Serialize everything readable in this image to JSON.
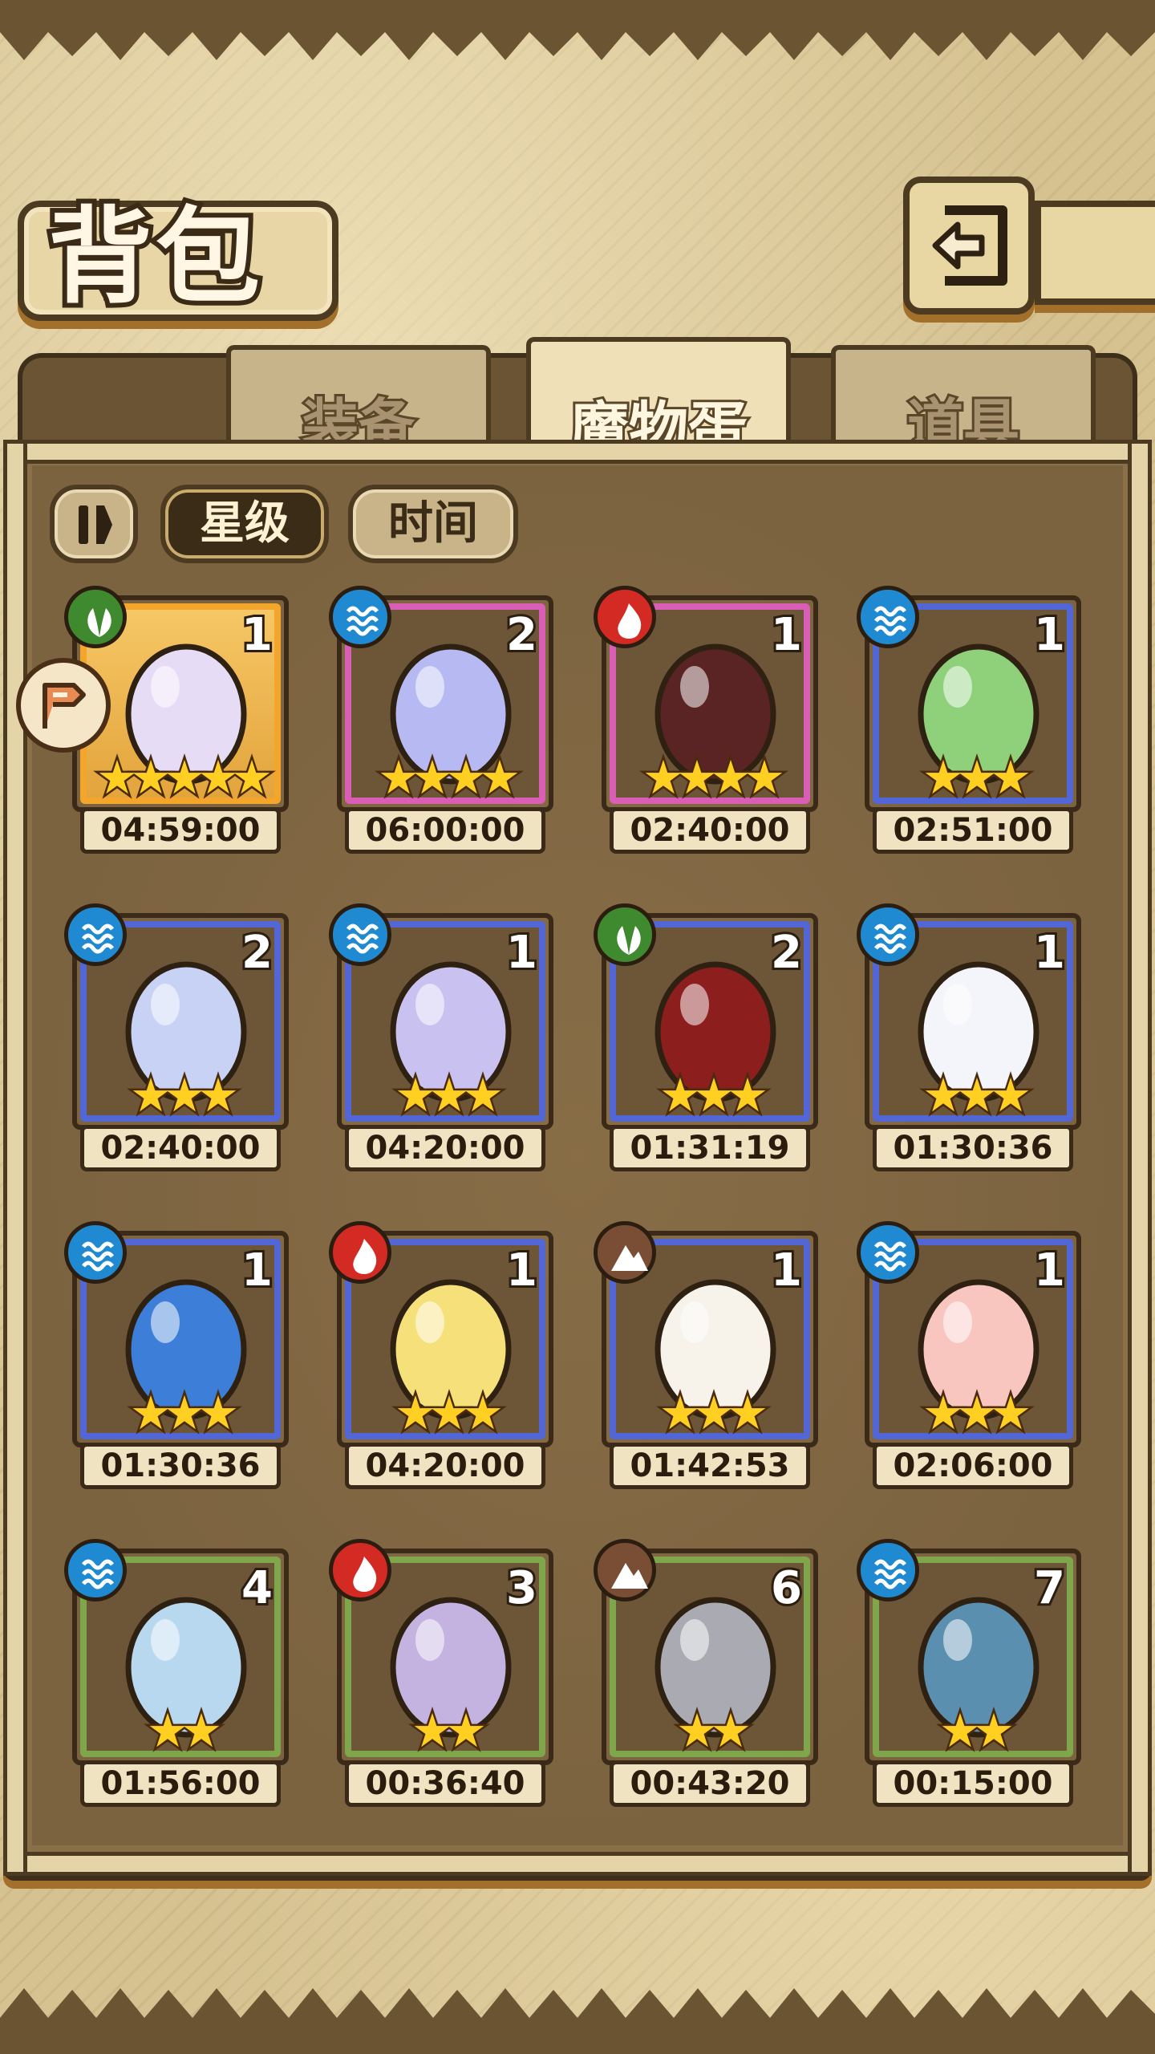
{
  "header": {
    "title": "背包"
  },
  "tabs": [
    {
      "label": "装备",
      "active": false
    },
    {
      "label": "魔物蛋",
      "active": true
    },
    {
      "label": "道具",
      "active": false
    }
  ],
  "sort": {
    "toggle_icon": "sort-order-icon",
    "options": [
      {
        "label": "星级",
        "selected": true
      },
      {
        "label": "时间",
        "selected": false
      }
    ]
  },
  "eggs": [
    {
      "element": "wood",
      "count": "1",
      "stars": "★★★★★",
      "star_count": 5,
      "timer": "04:59:00",
      "rarity": "gold"
    },
    {
      "element": "water",
      "count": "2",
      "stars": "★★★★",
      "star_count": 4,
      "timer": "06:00:00",
      "rarity": "pink"
    },
    {
      "element": "fire",
      "count": "1",
      "stars": "★★★★",
      "star_count": 4,
      "timer": "02:40:00",
      "rarity": "pink"
    },
    {
      "element": "water",
      "count": "1",
      "stars": "★★★",
      "star_count": 3,
      "timer": "02:51:00",
      "rarity": "blue"
    },
    {
      "element": "water",
      "count": "2",
      "stars": "★★★",
      "star_count": 3,
      "timer": "02:40:00",
      "rarity": "blue"
    },
    {
      "element": "water",
      "count": "1",
      "stars": "★★★",
      "star_count": 3,
      "timer": "04:20:00",
      "rarity": "blue"
    },
    {
      "element": "wood",
      "count": "2",
      "stars": "★★★",
      "star_count": 3,
      "timer": "01:31:19",
      "rarity": "blue"
    },
    {
      "element": "water",
      "count": "1",
      "stars": "★★★",
      "star_count": 3,
      "timer": "01:30:36",
      "rarity": "blue"
    },
    {
      "element": "water",
      "count": "1",
      "stars": "★★★",
      "star_count": 3,
      "timer": "01:30:36",
      "rarity": "blue"
    },
    {
      "element": "fire",
      "count": "1",
      "stars": "★★★",
      "star_count": 3,
      "timer": "04:20:00",
      "rarity": "blue"
    },
    {
      "element": "earth",
      "count": "1",
      "stars": "★★★",
      "star_count": 3,
      "timer": "01:42:53",
      "rarity": "blue"
    },
    {
      "element": "water",
      "count": "1",
      "stars": "★★★",
      "star_count": 3,
      "timer": "02:06:00",
      "rarity": "blue"
    },
    {
      "element": "water",
      "count": "4",
      "stars": "★★",
      "star_count": 2,
      "timer": "01:56:00",
      "rarity": "green"
    },
    {
      "element": "fire",
      "count": "3",
      "stars": "★★",
      "star_count": 2,
      "timer": "00:36:40",
      "rarity": "green"
    },
    {
      "element": "earth",
      "count": "6",
      "stars": "★★",
      "star_count": 2,
      "timer": "00:43:20",
      "rarity": "green"
    },
    {
      "element": "water",
      "count": "7",
      "stars": "★★",
      "star_count": 2,
      "timer": "00:15:00",
      "rarity": "green"
    }
  ],
  "colors": {
    "rarity_gold": "#f3a52c",
    "rarity_pink": "#d95fb6",
    "rarity_blue": "#5266d6",
    "rarity_green": "#7fa64a",
    "element_water": "#1f8ad1",
    "element_fire": "#d42a24",
    "element_wood": "#3f8a2f",
    "element_earth": "#7a4e34"
  }
}
